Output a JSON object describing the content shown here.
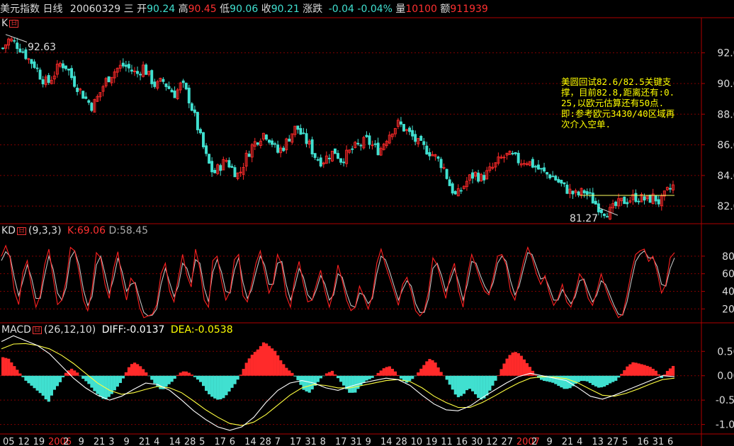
{
  "header": {
    "name": "美元指数",
    "period": "日线",
    "date": "20060329",
    "weekday": "三",
    "open_label": "开",
    "open": "90.24",
    "high_label": "高",
    "high": "90.45",
    "low_label": "低",
    "low": "90.06",
    "close_label": "收",
    "close": "90.21",
    "change_label": "涨跌",
    "change": "-0.04",
    "change_pct": "-0.04%",
    "volume_label": "量",
    "volume": "10100",
    "amount_label": "额",
    "amount": "911939"
  },
  "panels": {
    "k": {
      "title": "K",
      "badge": "日"
    },
    "kd": {
      "title": "KD",
      "badge": "日",
      "params": "(9,3,3)",
      "k_label": "K:",
      "k_value": "69.06",
      "d_label": "D:",
      "d_value": "58.45"
    },
    "macd": {
      "title": "MACD",
      "badge": "日",
      "params": "(26,12,10)",
      "diff_label": "DIFF:",
      "diff_value": "-0.0137",
      "dea_label": "DEA:",
      "dea_value": "-0.0538"
    }
  },
  "annotations": {
    "high_mark": "92.63",
    "low_mark": "81.27",
    "note": "美圆回试82.6/82.5关键支撑，目前82.8,距离还有:0.25,以欧元估算还有50点.即:参考欧元3430/40区域再次介入空单."
  },
  "x_axis_labels": [
    "05",
    "12",
    "19",
    "2006",
    "2",
    "9",
    "21",
    "3",
    "9",
    "21",
    "4",
    "14",
    "28",
    "5",
    "17",
    "6",
    "14",
    "28",
    "7",
    "17",
    "31",
    "8",
    "17",
    "31",
    "9",
    "14",
    "28",
    "10",
    "19",
    "11",
    "16",
    "30",
    "12",
    "27",
    "2007",
    "2",
    "9",
    "21",
    "4",
    "13",
    "27",
    "5",
    "16",
    "31",
    "6"
  ],
  "colors": {
    "up": "#ff2a2a",
    "down": "#40e0d0",
    "k_line": "#ff2020",
    "d_line": "#c0c0c0",
    "diff_line": "#ffffff",
    "dea_line": "#ffff40",
    "grid": "#800000"
  },
  "chart_data": [
    {
      "type": "candlestick",
      "title": "美元指数 日线",
      "y_ticks": [
        82.0,
        84.0,
        86.0,
        88.0,
        90.0,
        92.0
      ],
      "ylim": [
        80.9,
        93.6
      ],
      "close_path": [
        92.3,
        92.9,
        92.6,
        92.2,
        91.6,
        91.2,
        90.4,
        90.0,
        90.6,
        91.3,
        91.1,
        90.2,
        89.6,
        89.0,
        88.5,
        89.2,
        90.1,
        90.6,
        91.0,
        91.2,
        90.9,
        90.6,
        91.1,
        90.4,
        89.8,
        90.2,
        89.7,
        89.3,
        90.0,
        89.2,
        87.9,
        86.4,
        85.0,
        84.1,
        84.6,
        85.0,
        84.4,
        84.0,
        85.1,
        85.9,
        86.4,
        86.8,
        86.3,
        85.5,
        85.9,
        86.6,
        87.2,
        86.5,
        86.0,
        85.2,
        84.9,
        85.3,
        85.6,
        85.0,
        85.4,
        85.8,
        86.0,
        86.3,
        85.9,
        85.6,
        86.4,
        87.0,
        87.4,
        87.0,
        86.6,
        86.1,
        85.8,
        85.5,
        85.1,
        84.6,
        83.4,
        82.6,
        83.2,
        83.8,
        84.1,
        83.8,
        84.2,
        84.6,
        85.1,
        85.3,
        85.2,
        84.9,
        85.0,
        84.7,
        84.4,
        84.1,
        84.0,
        83.6,
        83.2,
        82.9,
        82.7,
        83.0,
        82.6,
        82.1,
        81.7,
        81.6,
        82.0,
        82.3,
        82.4,
        82.6,
        82.5,
        82.4,
        82.6,
        82.2,
        82.9,
        83.3
      ]
    },
    {
      "type": "line",
      "title": "KD",
      "y_ticks": [
        20,
        40,
        60,
        80
      ],
      "ylim": [
        5,
        100
      ],
      "series": [
        {
          "name": "K",
          "values": [
            80,
            92,
            78,
            40,
            25,
            62,
            75,
            45,
            22,
            35,
            70,
            88,
            55,
            25,
            30,
            52,
            90,
            86,
            62,
            30,
            18,
            42,
            84,
            78,
            48,
            32,
            66,
            85,
            52,
            30,
            55,
            48,
            22,
            10,
            12,
            14,
            25,
            60,
            72,
            40,
            28,
            55,
            82,
            58,
            45,
            88,
            66,
            30,
            22,
            75,
            80,
            52,
            30,
            40,
            76,
            82,
            35,
            28,
            48,
            72,
            86,
            62,
            38,
            50,
            82,
            70,
            35,
            22,
            55,
            74,
            48,
            28,
            30,
            48,
            64,
            40,
            22,
            40,
            70,
            52,
            30,
            18,
            22,
            46,
            34,
            20,
            35,
            72,
            88,
            70,
            55,
            40,
            24,
            48,
            56,
            40,
            18,
            12,
            18,
            40,
            78,
            70,
            50,
            32,
            58,
            72,
            40,
            22,
            58,
            82,
            68,
            52,
            40,
            36,
            56,
            80,
            82,
            70,
            40,
            30,
            52,
            74,
            90,
            78,
            60,
            48,
            58,
            38,
            24,
            32,
            48,
            28,
            22,
            38,
            60,
            52,
            32,
            24,
            40,
            60,
            44,
            30,
            20,
            10,
            14,
            36,
            62,
            82,
            86,
            88,
            74,
            80,
            62,
            38,
            48,
            78,
            84
          ]
        },
        {
          "name": "D",
          "values": [
            75,
            85,
            80,
            55,
            35,
            52,
            70,
            55,
            32,
            32,
            58,
            80,
            65,
            38,
            30,
            44,
            78,
            86,
            70,
            42,
            24,
            34,
            70,
            80,
            60,
            38,
            54,
            78,
            62,
            40,
            48,
            50,
            32,
            16,
            12,
            13,
            20,
            48,
            66,
            50,
            34,
            46,
            72,
            66,
            50,
            76,
            72,
            44,
            28,
            62,
            76,
            62,
            40,
            38,
            64,
            78,
            50,
            32,
            42,
            62,
            80,
            70,
            48,
            48,
            72,
            74,
            48,
            30,
            46,
            66,
            56,
            36,
            30,
            42,
            58,
            48,
            30,
            36,
            60,
            56,
            38,
            24,
            22,
            38,
            36,
            26,
            32,
            60,
            80,
            76,
            62,
            46,
            30,
            42,
            52,
            46,
            26,
            16,
            16,
            32,
            66,
            72,
            58,
            40,
            52,
            66,
            50,
            30,
            48,
            74,
            72,
            58,
            46,
            38,
            50,
            72,
            80,
            74,
            52,
            36,
            46,
            66,
            84,
            82,
            68,
            54,
            56,
            44,
            30,
            30,
            42,
            34,
            26,
            34,
            52,
            54,
            40,
            28,
            36,
            52,
            48,
            36,
            24,
            14,
            13,
            28,
            52,
            74,
            82,
            86,
            78,
            78,
            68,
            48,
            46,
            66,
            78
          ]
        }
      ]
    },
    {
      "type": "bar+line",
      "title": "MACD",
      "y_ticks": [
        -1.0,
        -0.5,
        0.0,
        0.5
      ],
      "ylim": [
        -1.18,
        0.78
      ],
      "macd_bars": [
        0.38,
        0.35,
        0.2,
        0.05,
        -0.1,
        -0.2,
        -0.3,
        -0.4,
        -0.55,
        -0.3,
        -0.15,
        0.05,
        0.15,
        0.08,
        -0.05,
        -0.15,
        -0.3,
        -0.42,
        -0.5,
        -0.4,
        -0.25,
        -0.1,
        0.15,
        0.28,
        0.22,
        0.1,
        -0.05,
        -0.2,
        -0.3,
        -0.2,
        -0.1,
        0.05,
        0.1,
        0.05,
        -0.05,
        -0.15,
        -0.35,
        -0.45,
        -0.5,
        -0.45,
        -0.3,
        -0.15,
        0.05,
        0.3,
        0.45,
        0.55,
        0.7,
        0.6,
        0.5,
        0.3,
        0.15,
        0.05,
        -0.1,
        -0.3,
        -0.35,
        -0.2,
        -0.05,
        0.05,
        0.1,
        -0.05,
        -0.2,
        -0.35,
        -0.35,
        -0.2,
        -0.1,
        -0.05,
        0.05,
        0.15,
        0.2,
        0.1,
        -0.05,
        -0.15,
        -0.08,
        0.05,
        0.2,
        0.35,
        0.3,
        0.1,
        -0.05,
        -0.25,
        -0.45,
        -0.4,
        -0.25,
        -0.35,
        -0.5,
        -0.45,
        -0.25,
        -0.05,
        0.2,
        0.4,
        0.5,
        0.45,
        0.3,
        0.15,
        -0.02,
        -0.1,
        -0.12,
        -0.15,
        -0.22,
        -0.28,
        -0.25,
        -0.15,
        -0.1,
        -0.12,
        -0.2,
        -0.25,
        -0.22,
        -0.15,
        -0.1,
        0.05,
        0.2,
        0.28,
        0.25,
        0.22,
        0.18,
        0.1,
        -0.05,
        0.1,
        0.2
      ],
      "series": [
        {
          "name": "DIFF",
          "values": [
            0.7,
            0.82,
            0.72,
            0.62,
            0.45,
            0.2,
            -0.05,
            -0.25,
            -0.4,
            -0.5,
            -0.42,
            -0.28,
            -0.15,
            -0.18,
            -0.3,
            -0.5,
            -0.72,
            -0.9,
            -1.05,
            -1.12,
            -1.05,
            -0.85,
            -0.55,
            -0.3,
            -0.15,
            -0.1,
            -0.15,
            -0.25,
            -0.3,
            -0.22,
            -0.15,
            -0.1,
            -0.05,
            -0.08,
            -0.2,
            -0.4,
            -0.58,
            -0.7,
            -0.72,
            -0.62,
            -0.45,
            -0.3,
            -0.15,
            -0.02,
            0.05,
            0.0,
            -0.05,
            -0.1,
            -0.25,
            -0.42,
            -0.48,
            -0.4,
            -0.3,
            -0.2,
            -0.1,
            0.0,
            -0.02
          ]
        },
        {
          "name": "DEA",
          "values": [
            0.55,
            0.65,
            0.66,
            0.62,
            0.55,
            0.42,
            0.25,
            0.05,
            -0.15,
            -0.3,
            -0.38,
            -0.35,
            -0.28,
            -0.22,
            -0.25,
            -0.35,
            -0.52,
            -0.7,
            -0.85,
            -0.98,
            -1.02,
            -0.95,
            -0.8,
            -0.6,
            -0.4,
            -0.25,
            -0.18,
            -0.2,
            -0.25,
            -0.25,
            -0.2,
            -0.15,
            -0.1,
            -0.08,
            -0.12,
            -0.25,
            -0.42,
            -0.55,
            -0.65,
            -0.65,
            -0.55,
            -0.42,
            -0.28,
            -0.15,
            -0.05,
            -0.02,
            -0.03,
            -0.06,
            -0.15,
            -0.28,
            -0.4,
            -0.42,
            -0.36,
            -0.27,
            -0.17,
            -0.08,
            -0.05
          ]
        }
      ]
    }
  ]
}
